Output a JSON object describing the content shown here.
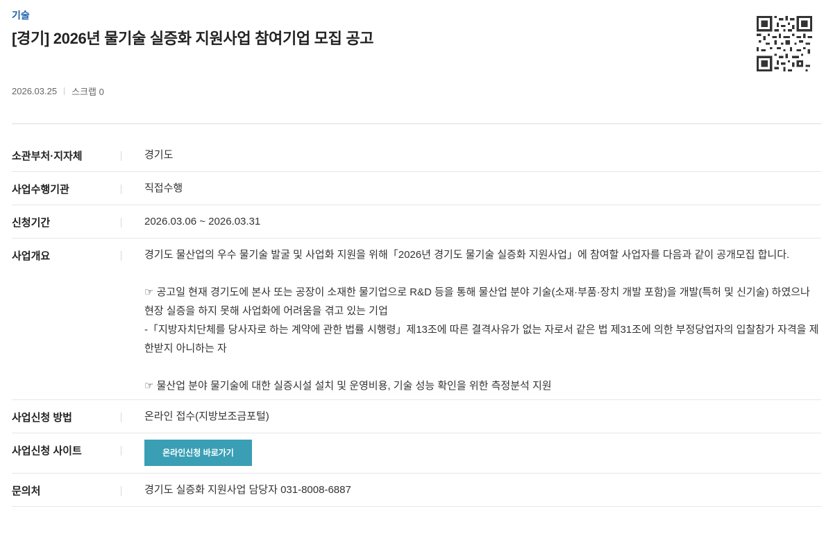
{
  "header": {
    "category": "기술",
    "title": "[경기] 2026년 물기술 실증화 지원사업 참여기업 모집 공고",
    "date": "2026.03.25",
    "scrap_label": "스크랩 0",
    "qr_icon": "qr-code-icon"
  },
  "details": {
    "agency_label": "소관부처·지자체",
    "agency_value": "경기도",
    "executor_label": "사업수행기관",
    "executor_value": "직접수행",
    "period_label": "신청기간",
    "period_value": "2026.03.06 ~ 2026.03.31",
    "overview_label": "사업개요",
    "overview_lines": [
      "경기도 물산업의 우수 물기술 발굴 및 사업화 지원을 위해「2026년 경기도 물기술 실증화 지원사업」에 참여할 사업자를 다음과 같이 공개모집 합니다.",
      "☞ 공고일 현재 경기도에 본사 또는 공장이 소재한 물기업으로 R&D 등을 통해 물산업 분야 기술(소재·부품·장치 개발 포함)을 개발(특허 및 신기술) 하였으나 현장 실증을 하지 못해 사업화에 어려움을 겪고 있는 기업",
      "-「지방자치단체를 당사자로 하는 계약에 관한 법률 시행령」제13조에 따른 결격사유가 없는 자로서 같은 법 제31조에 의한 부정당업자의 입찰참가 자격을 제한받지 아니하는 자",
      "☞ 물산업 분야 물기술에 대한 실증시설 설치 및 운영비용, 기술 성능 확인을 위한 측정분석 지원"
    ],
    "method_label": "사업신청 방법",
    "method_value": "온라인 접수(지방보조금포털)",
    "site_label": "사업신청 사이트",
    "site_button": "온라인신청 바로가기",
    "contact_label": "문의처",
    "contact_value": "경기도 실증화 지원사업 담당자 031-8008-6887"
  }
}
